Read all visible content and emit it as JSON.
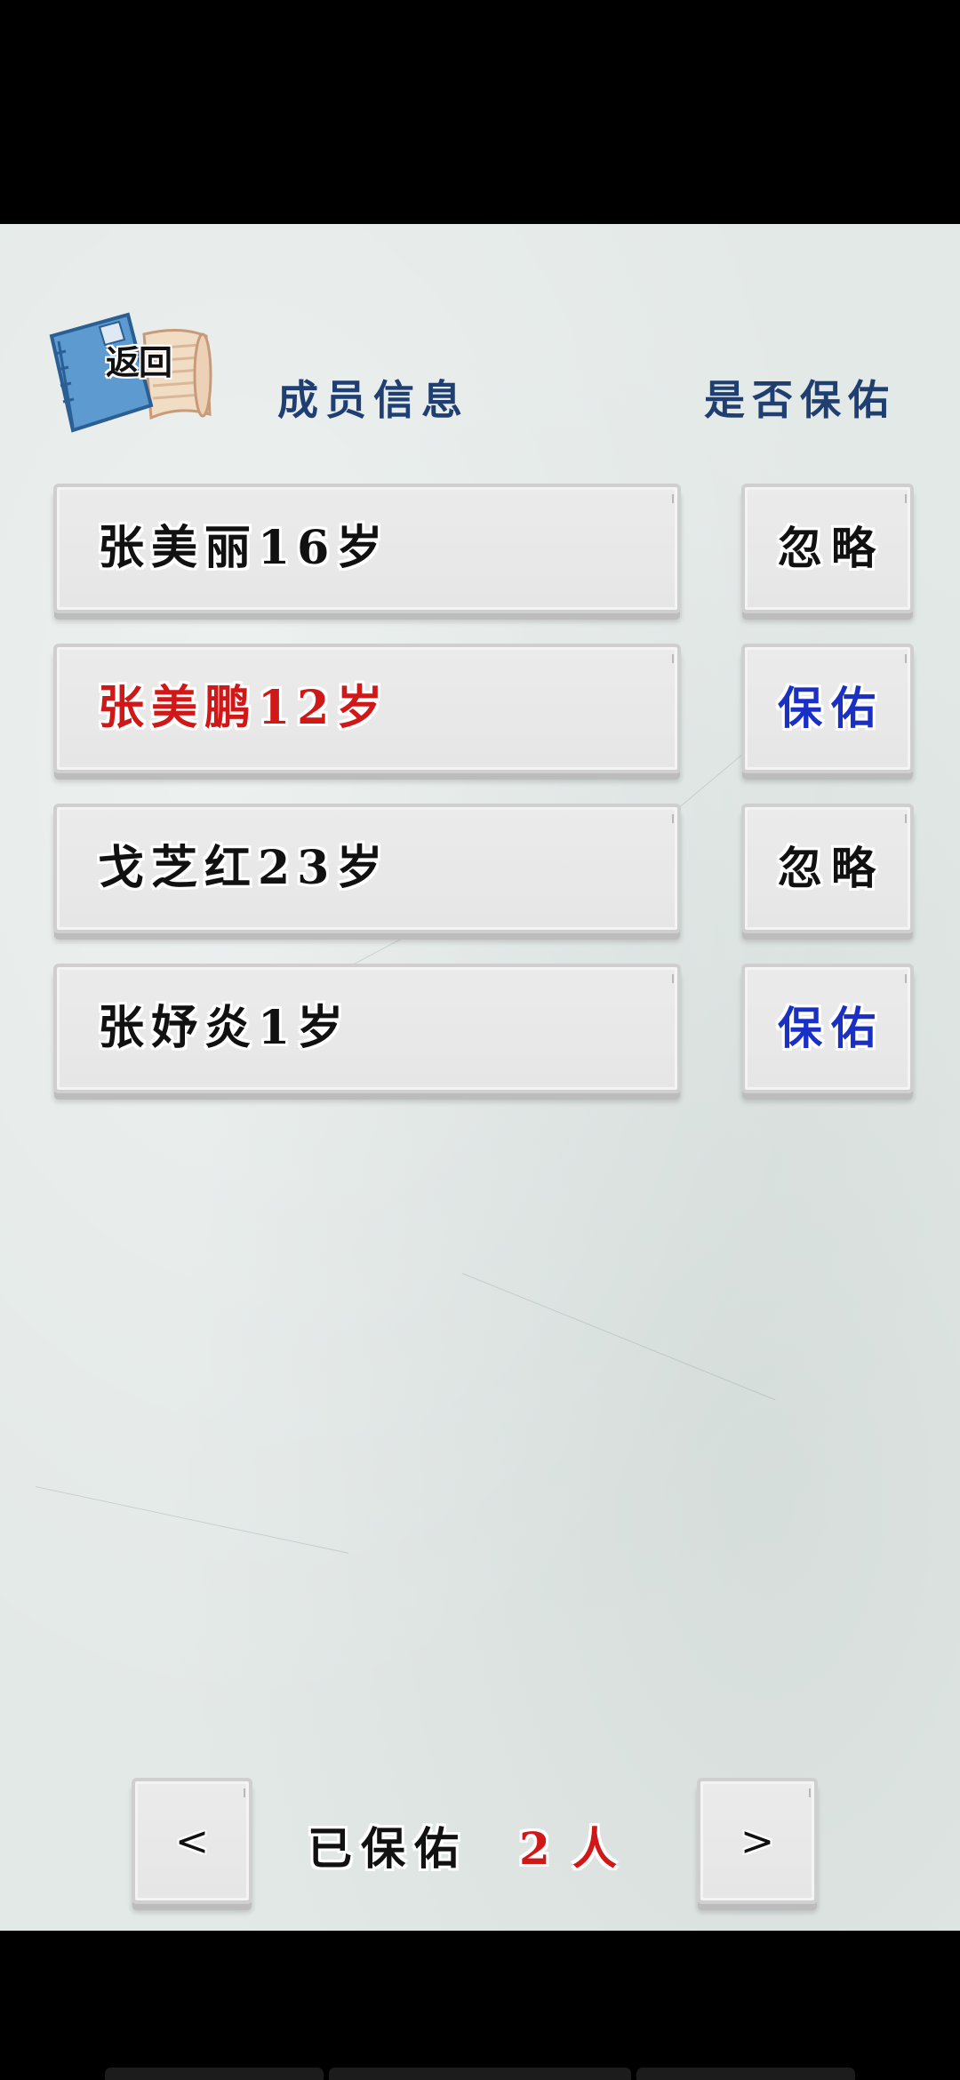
{
  "header": {
    "back_label": "返回",
    "col_member": "成员信息",
    "col_protect": "是否保佑"
  },
  "members": [
    {
      "label": "张美丽16岁",
      "status": "忽略",
      "label_color": "#111111",
      "status_color": "#111111"
    },
    {
      "label": "张美鹏12岁",
      "status": "保佑",
      "label_color": "#d01818",
      "status_color": "#1a2fc4"
    },
    {
      "label": "戈芝红23岁",
      "status": "忽略",
      "label_color": "#111111",
      "status_color": "#111111"
    },
    {
      "label": "张妤炎1岁",
      "status": "保佑",
      "label_color": "#111111",
      "status_color": "#1a2fc4"
    }
  ],
  "footer": {
    "prev_label": "<",
    "next_label": ">",
    "protected_label": "已保佑",
    "protected_count": "2",
    "unit": "人"
  },
  "colors": {
    "header_text": "#1f3f73",
    "protected_blue": "#1a2fc4",
    "highlight_red": "#d01818"
  }
}
